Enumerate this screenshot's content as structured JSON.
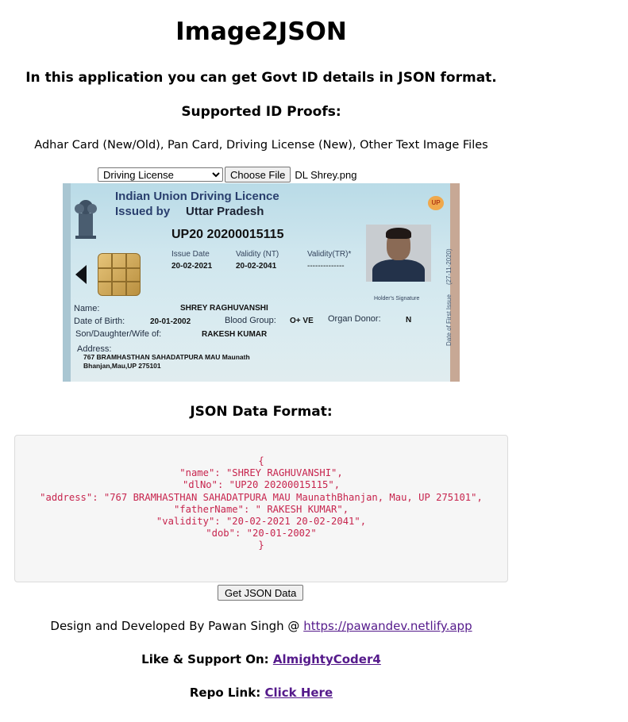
{
  "header": {
    "title": "Image2JSON",
    "subtitle": "In this application you can get Govt ID details in JSON format.",
    "supported_heading": "Supported ID Proofs:",
    "supported_list": "Adhar Card (New/Old), Pan Card, Driving License (New), Other Text Image Files"
  },
  "upload": {
    "selected_type": "Driving License",
    "options": [
      "Driving License"
    ],
    "choose_file_label": "Choose File",
    "file_name": "DL Shrey.png"
  },
  "card": {
    "header_line1": "Indian Union Driving Licence",
    "header_line2": "Issued by",
    "state": "Uttar Pradesh",
    "badge": "UP",
    "dl_number": "UP20 20200015115",
    "issue_date_label": "Issue Date",
    "validity_nt_label": "Validity (NT)",
    "validity_tr_label": "Validity(TR)*",
    "issue_date": "20-02-2021",
    "validity_nt": "20-02-2041",
    "validity_tr": "--------------",
    "holder_signature": "Holder's Signature",
    "first_issue_vertical": "Date of First Issue",
    "first_issue_date_vertical": "(27-11-2020)",
    "name_label": "Name:",
    "name": "SHREY RAGHUVANSHI",
    "dob_label": "Date of Birth:",
    "dob": "20-01-2002",
    "blood_group_label": "Blood Group:",
    "blood_group": "O+ VE",
    "organ_donor_label": "Organ Donor:",
    "organ_donor": "N",
    "relation_label": "Son/Daughter/Wife of:",
    "relation": "RAKESH KUMAR",
    "address_label": "Address:",
    "address_line1": "767 BRAMHASTHAN SAHADATPURA MAU Maunath",
    "address_line2": "Bhanjan,Mau,UP 275101"
  },
  "json_section": {
    "heading": "JSON Data Format:",
    "lines": [
      "{",
      "\"name\": \"SHREY RAGHUVANSHI\",",
      "\"dlNo\": \"UP20 20200015115\",",
      "\"address\": \"767 BRAMHASTHAN SAHADATPURA MAU MaunathBhanjan, Mau, UP 275101\",",
      "\"fatherName\": \" RAKESH KUMAR\",",
      "\"validity\": \"20-02-2021 20-02-2041\",",
      "\"dob\": \"20-01-2002\"",
      "}"
    ],
    "button_label": "Get JSON Data"
  },
  "footer": {
    "credit_text": "Design and Developed By Pawan Singh @ ",
    "credit_link": "https://pawandev.netlify.app",
    "support_text": "Like & Support On: ",
    "support_link": "AlmightyCoder4",
    "repo_text": "Repo Link: ",
    "repo_link": "Click Here"
  }
}
